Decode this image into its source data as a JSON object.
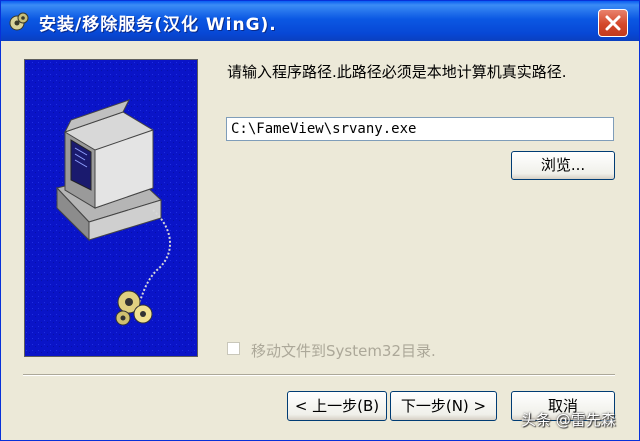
{
  "window": {
    "title": "安装/移除服务(汉化 WinG)."
  },
  "main": {
    "prompt": "请输入程序路径.此路径必须是本地计算机真实路径.",
    "path_value": "C:\\FameView\\srvany.exe",
    "browse_label": "浏览...",
    "checkbox_label": "移动文件到System32目录."
  },
  "footer": {
    "back_label": "< 上一步(B)",
    "next_label": "下一步(N) >",
    "cancel_label": "取消"
  },
  "watermark": "头条 @雷先森",
  "colors": {
    "titlebar": "#0b58e3",
    "side_panel": "#0a14c8",
    "dialog_bg": "#ece9d8",
    "close_button": "#d4482b"
  },
  "icons": {
    "title": "setup-icon",
    "close": "close-icon",
    "illustration": "computer-illustration"
  }
}
